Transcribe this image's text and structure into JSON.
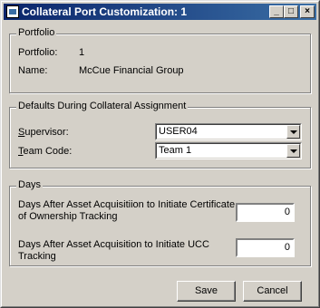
{
  "window": {
    "title": "Collateral Port Customization: 1",
    "min_glyph": "_",
    "max_glyph": "□",
    "close_glyph": "×"
  },
  "portfolio": {
    "group_title": "Portfolio",
    "portfolio_label": "Portfolio:",
    "portfolio_value": "1",
    "name_label": "Name:",
    "name_value": "McCue Financial Group"
  },
  "defaults": {
    "group_title": "Defaults During Collateral Assignment",
    "supervisor_label_first": "S",
    "supervisor_label_rest": "upervisor:",
    "supervisor_value": "USER04",
    "team_label_first": "T",
    "team_label_rest": "eam Code:",
    "team_value": "Team 1"
  },
  "days": {
    "group_title": "Days",
    "cert_label_line1": "Days After Asset Acquisitiion to Initiate Certificate",
    "cert_label_line2": "of Ownership Tracking",
    "cert_value": "0",
    "ucc_label_line1": "Days After Asset Acquisition to Initiate UCC",
    "ucc_label_line2": "Tracking",
    "ucc_value": "0"
  },
  "buttons": {
    "save": "Save",
    "cancel": "Cancel"
  }
}
